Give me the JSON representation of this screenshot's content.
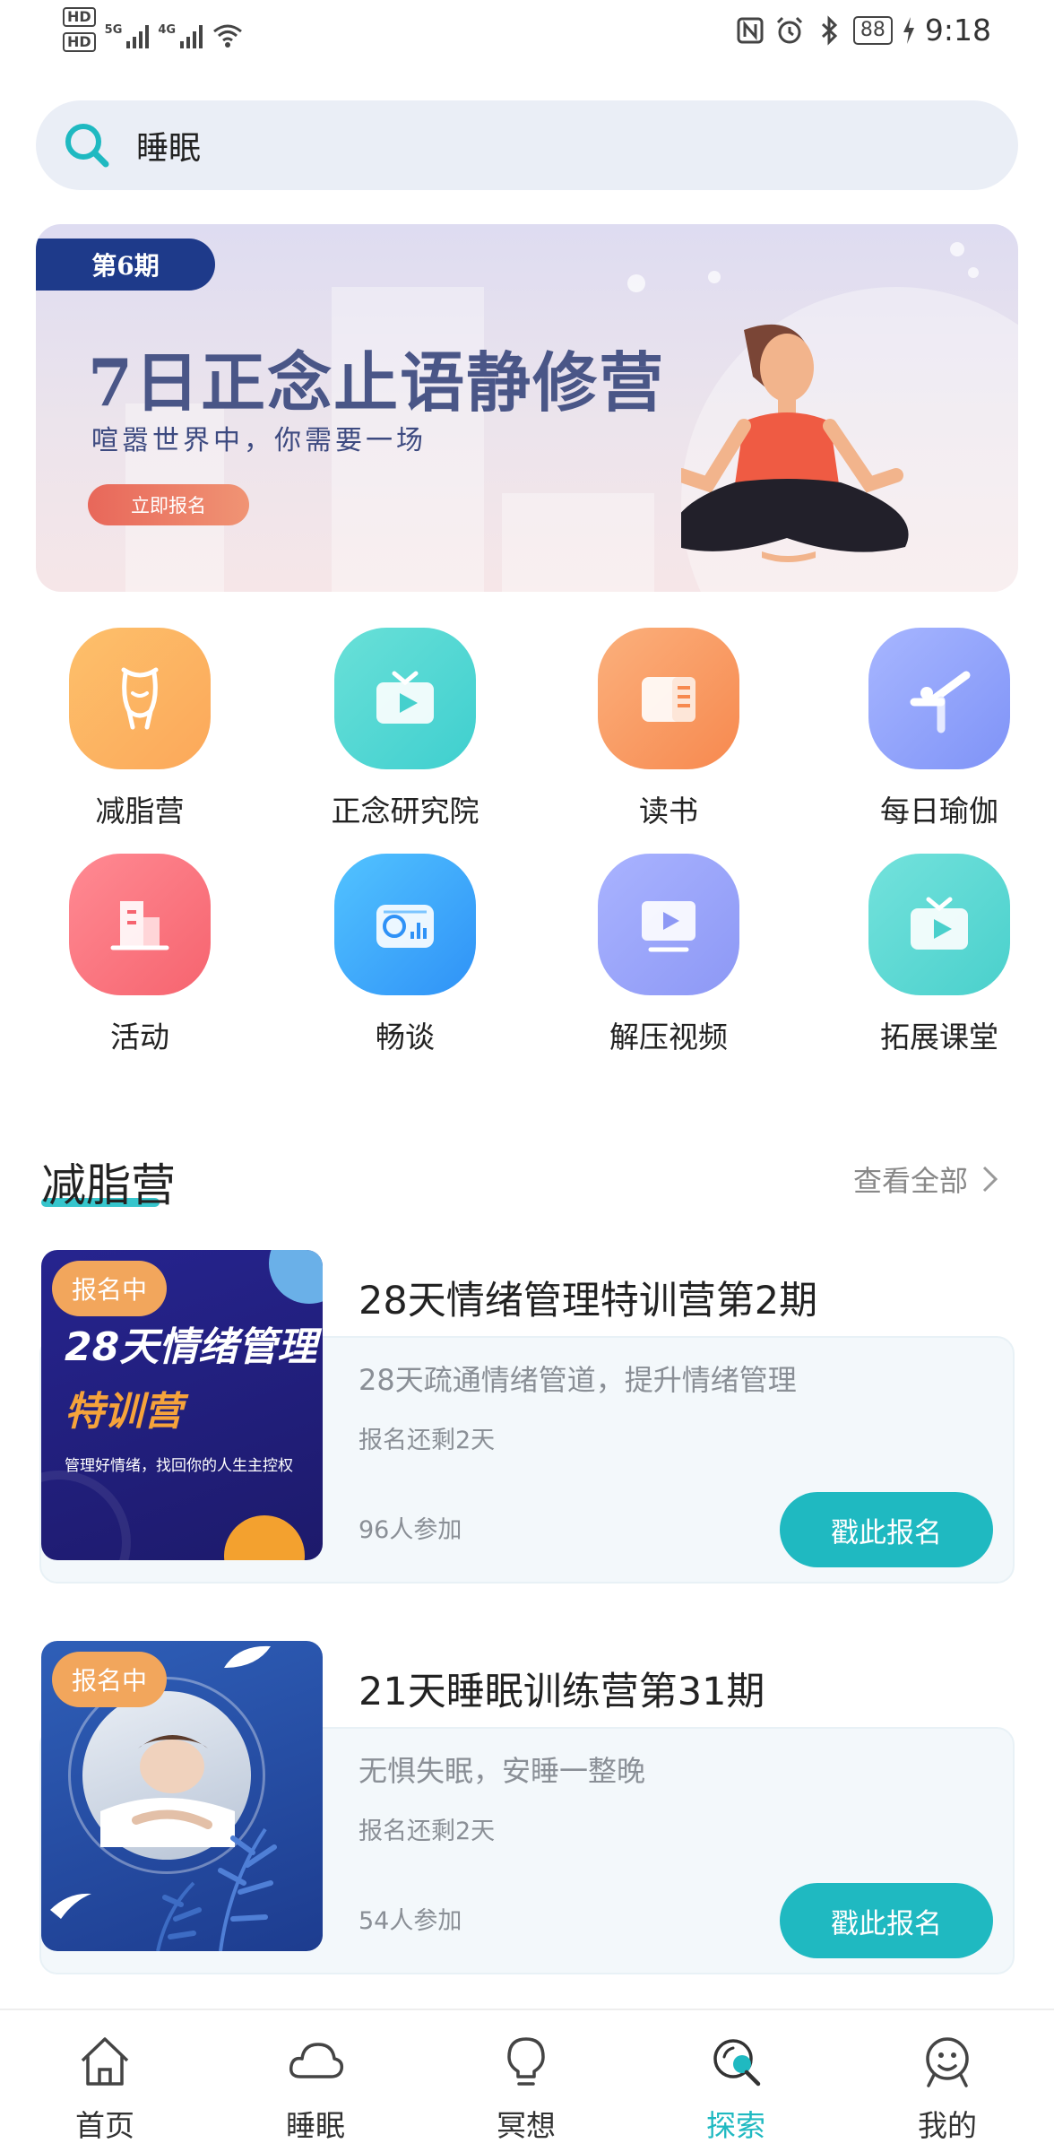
{
  "status": {
    "hd1": "HD",
    "hd2": "HD",
    "net1": "5G",
    "net2": "4G",
    "battery": "88",
    "time": "9:18"
  },
  "search": {
    "value": "睡眠"
  },
  "banner": {
    "issue": "第6期",
    "title": "7日正念止语静修营",
    "subtitle": "喧嚣世界中，你需要一场",
    "button": "立即报名"
  },
  "grid": [
    {
      "label": "减脂营",
      "icon": "body-icon",
      "color_from": "#fdc06b",
      "color_to": "#fca85a"
    },
    {
      "label": "正念研究院",
      "icon": "tv-icon",
      "color_from": "#69e0d8",
      "color_to": "#3fcfcf"
    },
    {
      "label": "读书",
      "icon": "book-icon",
      "color_from": "#fbb07c",
      "color_to": "#f7894f"
    },
    {
      "label": "每日瑜伽",
      "icon": "yoga-icon",
      "color_from": "#a7b6ff",
      "color_to": "#7f93f7"
    },
    {
      "label": "活动",
      "icon": "building-icon",
      "color_from": "#ff8a93",
      "color_to": "#f6646f"
    },
    {
      "label": "畅谈",
      "icon": "radio-icon",
      "color_from": "#52c3ff",
      "color_to": "#2f92f7"
    },
    {
      "label": "解压视频",
      "icon": "monitor-play-icon",
      "color_from": "#a9b3ff",
      "color_to": "#8d98f5"
    },
    {
      "label": "拓展课堂",
      "icon": "tv-icon",
      "color_from": "#73e2dc",
      "color_to": "#4ad0cc"
    }
  ],
  "section": {
    "title": "减脂营",
    "view_all": "查看全部"
  },
  "cards": [
    {
      "badge": "报名中",
      "img_title1": "28天情绪管理",
      "img_title2": "特训营",
      "img_caption": "管理好情绪，找回你的人生主控权",
      "title": "28天情绪管理特训营第2期",
      "desc": "28天疏通情绪管道，提升情绪管理",
      "remaining": "报名还剩2天",
      "participants": "96人参加",
      "button": "戳此报名"
    },
    {
      "badge": "报名中",
      "title": "21天睡眠训练营第31期",
      "desc": "无惧失眠，安睡一整晚",
      "remaining": "报名还剩2天",
      "participants": "54人参加",
      "button": "戳此报名"
    }
  ],
  "tabs": [
    {
      "label": "首页",
      "icon": "home-icon"
    },
    {
      "label": "睡眠",
      "icon": "cloud-icon"
    },
    {
      "label": "冥想",
      "icon": "bulb-icon"
    },
    {
      "label": "探索",
      "icon": "explore-icon",
      "active": true
    },
    {
      "label": "我的",
      "icon": "profile-icon"
    }
  ],
  "colors": {
    "accent": "#1fb9c1",
    "search_bg": "#eaeef6"
  }
}
